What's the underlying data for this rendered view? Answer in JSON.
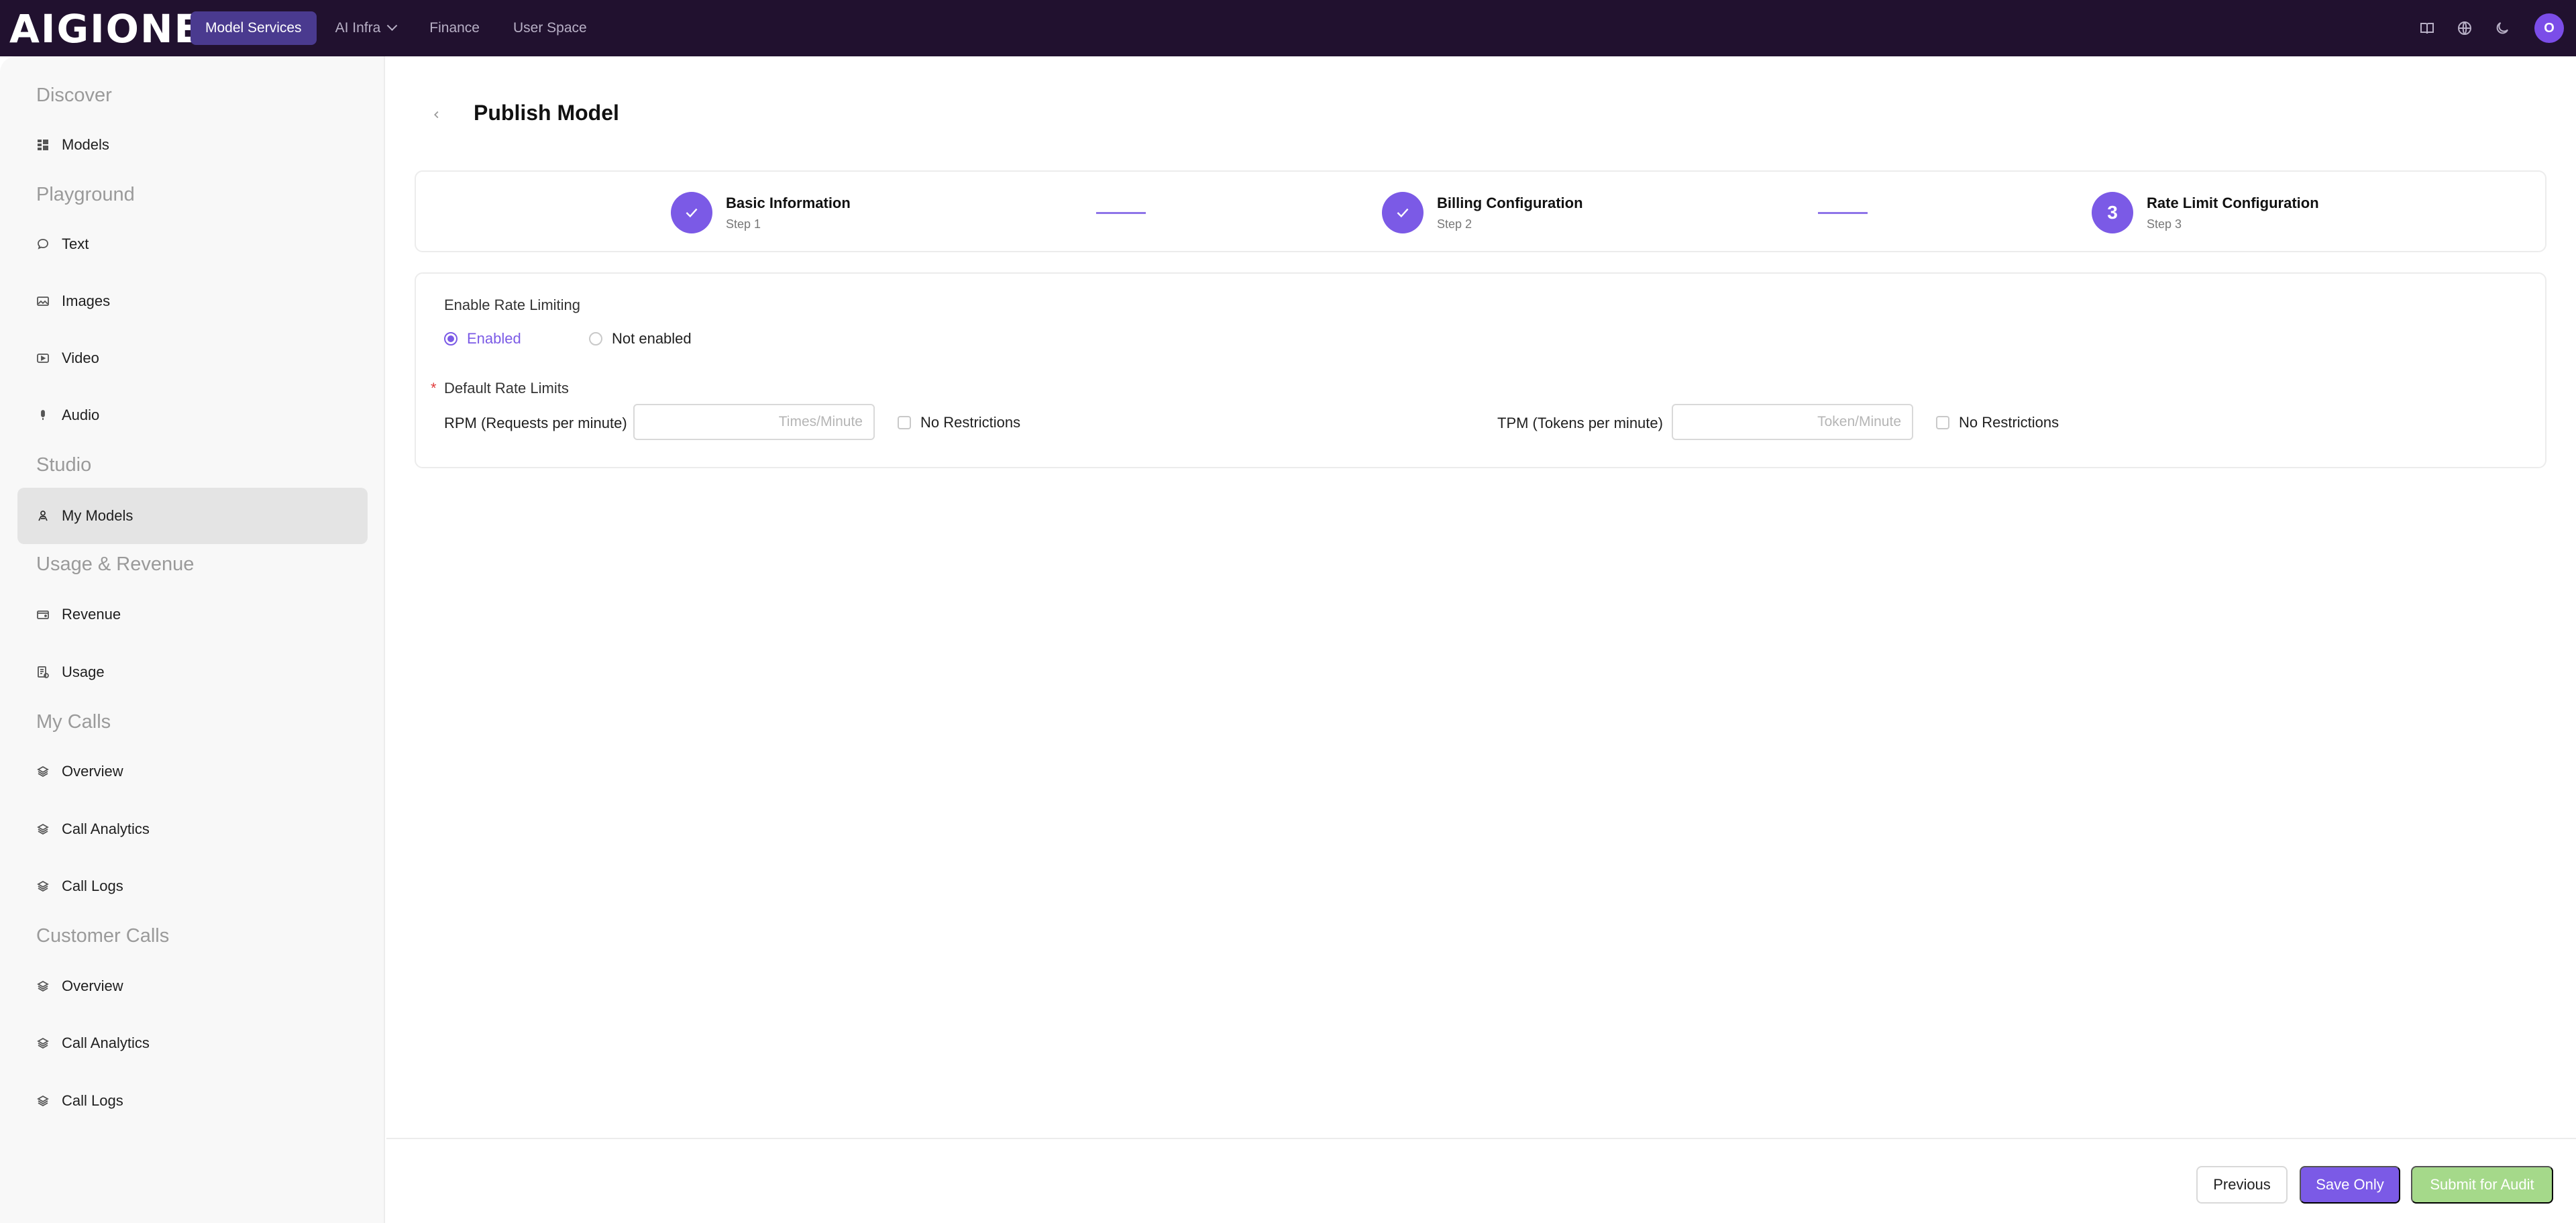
{
  "app": {
    "logo_text": "AIGIONE"
  },
  "topnav": {
    "items": [
      {
        "label": "Model Services"
      },
      {
        "label": "AI Infra"
      },
      {
        "label": "Finance"
      },
      {
        "label": "User Space"
      }
    ],
    "icons": [
      "book-icon",
      "globe-icon",
      "moon-icon"
    ],
    "avatar_initial": "O"
  },
  "sidebar": {
    "sections": [
      {
        "title": "Discover",
        "items": [
          {
            "label": "Models",
            "icon": "grid-icon"
          }
        ]
      },
      {
        "title": "Playground",
        "items": [
          {
            "label": "Text",
            "icon": "chat-icon"
          },
          {
            "label": "Images",
            "icon": "image-icon"
          },
          {
            "label": "Video",
            "icon": "video-icon"
          },
          {
            "label": "Audio",
            "icon": "mic-icon"
          }
        ]
      },
      {
        "title": "Studio",
        "items": [
          {
            "label": "My Models",
            "icon": "models-icon",
            "active": true
          }
        ]
      },
      {
        "title": "Usage & Revenue",
        "items": [
          {
            "label": "Revenue",
            "icon": "wallet-icon"
          },
          {
            "label": "Usage",
            "icon": "doc-icon"
          }
        ]
      },
      {
        "title": "My Calls",
        "items": [
          {
            "label": "Overview",
            "icon": "layers-icon"
          },
          {
            "label": "Call Analytics",
            "icon": "layers-icon"
          },
          {
            "label": "Call Logs",
            "icon": "layers-icon"
          }
        ]
      },
      {
        "title": "Customer Calls",
        "items": [
          {
            "label": "Overview",
            "icon": "layers-icon"
          },
          {
            "label": "Call Analytics",
            "icon": "layers-icon"
          },
          {
            "label": "Call Logs",
            "icon": "layers-icon"
          }
        ]
      }
    ]
  },
  "page": {
    "title": "Publish Model"
  },
  "steps": [
    {
      "title": "Basic Information",
      "sub": "Step 1",
      "status": "done"
    },
    {
      "title": "Billing Configuration",
      "sub": "Step 2",
      "status": "done"
    },
    {
      "title": "Rate Limit Configuration",
      "sub": "Step 3",
      "number": "3",
      "status": "current"
    }
  ],
  "form": {
    "enable_label": "Enable Rate Limiting",
    "options": [
      "Enabled",
      "Not enabled"
    ],
    "selected": "Enabled",
    "default_limits_label": "Default Rate Limits",
    "rpm_label": "RPM (Requests per minute)",
    "rpm_placeholder": "Times/Minute",
    "rpm_value": "",
    "rpm_no_restrictions": "No Restrictions",
    "tpm_label": "TPM (Tokens per minute)",
    "tpm_placeholder": "Token/Minute",
    "tpm_value": "",
    "tpm_no_restrictions": "No Restrictions"
  },
  "footer": {
    "previous": "Previous",
    "save_only": "Save Only",
    "submit": "Submit for Audit"
  },
  "colors": {
    "accent": "#7b5ae6",
    "topbar": "#21112f",
    "submit_disabled": "#a5d98a"
  }
}
